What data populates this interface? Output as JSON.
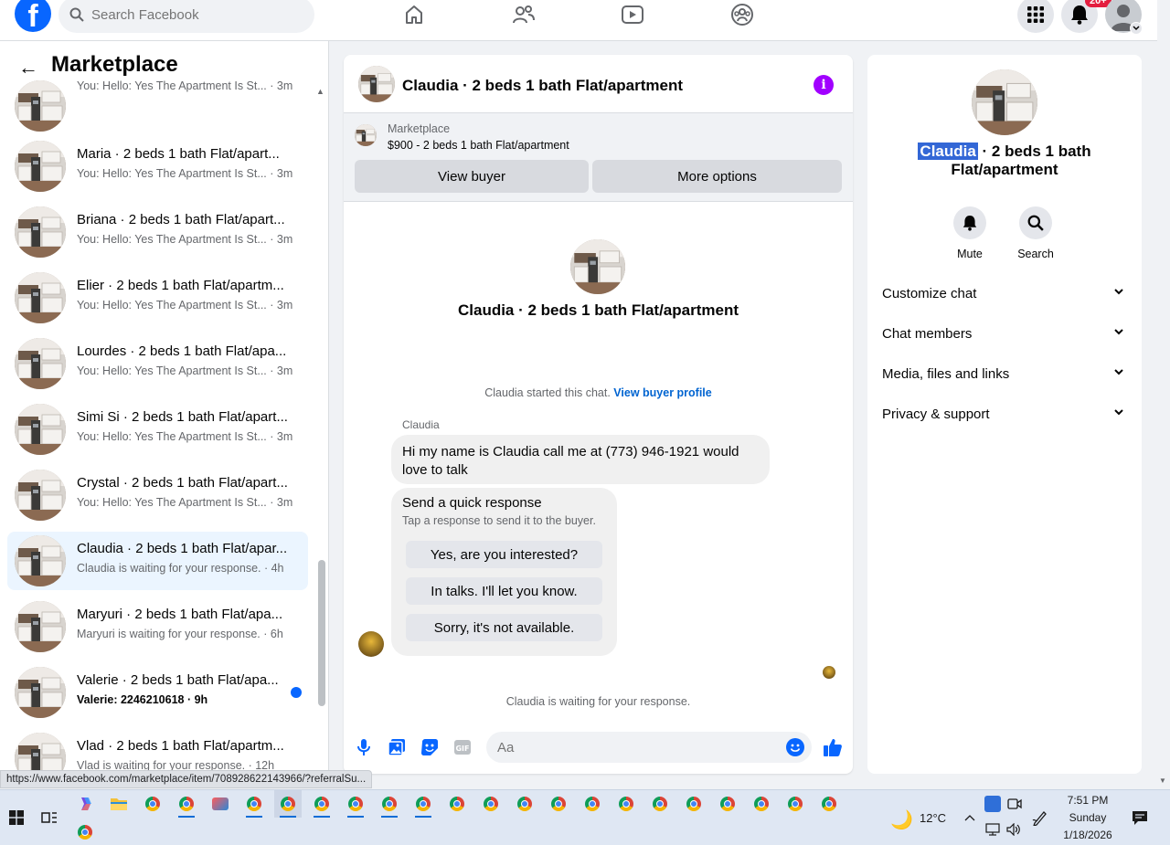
{
  "topnav": {
    "logo_text": "f",
    "search_placeholder": "Search Facebook",
    "notifications_badge": "20+",
    "icons": [
      "home-icon",
      "friends-icon",
      "watch-icon",
      "groups-icon",
      "menu-grid-icon",
      "bell-icon",
      "account-avatar"
    ]
  },
  "sidebar": {
    "back_label": "←",
    "title": "Marketplace",
    "conversations": [
      {
        "title": "",
        "subtitle": "You: Hello: Yes The Apartment Is St... · 3m"
      },
      {
        "title": "Maria · 2 beds 1 bath Flat/apart...",
        "subtitle": "You: Hello: Yes The Apartment Is St... · 3m"
      },
      {
        "title": "Briana · 2 beds 1 bath Flat/apart...",
        "subtitle": "You: Hello: Yes The Apartment Is St... · 3m"
      },
      {
        "title": "Elier · 2 beds 1 bath Flat/apartm...",
        "subtitle": "You: Hello: Yes The Apartment Is St... · 3m"
      },
      {
        "title": "Lourdes · 2 beds 1 bath Flat/apa...",
        "subtitle": "You: Hello: Yes The Apartment Is St... · 3m"
      },
      {
        "title": "Simi Si · 2 beds 1 bath Flat/apart...",
        "subtitle": "You: Hello: Yes The Apartment Is St... · 3m"
      },
      {
        "title": "Crystal · 2 beds 1 bath Flat/apart...",
        "subtitle": "You: Hello: Yes The Apartment Is St... · 3m"
      },
      {
        "title": "Claudia · 2 beds 1 bath Flat/apar...",
        "subtitle": "Claudia is waiting for your response. · 4h"
      },
      {
        "title": "Maryuri · 2 beds 1 bath Flat/apa...",
        "subtitle": "Maryuri is waiting for your response. · 6h"
      },
      {
        "title": "Valerie · 2 beds 1 bath Flat/apa...",
        "subtitle": "Valerie: 2246210618 · 9h"
      },
      {
        "title": "Vlad · 2 beds 1 bath Flat/apartm...",
        "subtitle": "Vlad is waiting for your response. · 12h"
      }
    ]
  },
  "chat": {
    "header_title": "Claudia · 2 beds 1 bath Flat/apartment",
    "info_glyph": "i",
    "listing_label": "Marketplace",
    "listing_price": "$900 - 2 beds 1 bath Flat/apartment",
    "view_buyer_label": "View buyer",
    "more_options_label": "More options",
    "center_name": "Claudia · 2 beds 1 bath Flat/apartment",
    "started_text": "Claudia started this chat.",
    "buyer_profile_link": "View buyer profile",
    "sender_name": "Claudia",
    "message_text": "Hi my name is Claudia call me at (773) 946-1921 would love to talk",
    "quick_title": "Send a quick response",
    "quick_subtitle": "Tap a response to send it to the buyer.",
    "quick_replies": [
      "Yes, are you interested?",
      "In talks. I'll let you know.",
      "Sorry, it's not available."
    ],
    "waiting_text": "Claudia is waiting for your response.",
    "composer_placeholder": "Aa"
  },
  "details": {
    "name_highlight": "Claudia",
    "name_rest": " · 2 beds 1 bath Flat/apartment",
    "mute_label": "Mute",
    "search_label": "Search",
    "sections": [
      "Customize chat",
      "Chat members",
      "Media, files and links",
      "Privacy & support"
    ]
  },
  "status_url": "https://www.facebook.com/marketplace/item/708928622143966/?referralSu...",
  "taskbar": {
    "weather_temp": "12°C",
    "time": "7:51 PM",
    "day": "Sunday",
    "date": "1/18/2026"
  },
  "colors": {
    "brand_blue": "#0866ff",
    "active_row": "#ebf5ff",
    "info_purple": "#a100ff",
    "badge_red": "#e41e3f"
  }
}
